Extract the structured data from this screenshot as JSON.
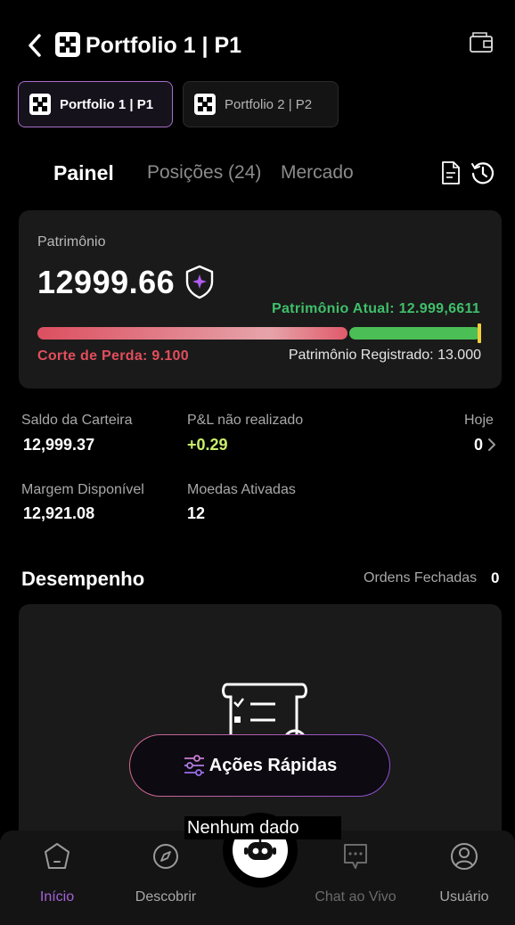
{
  "header": {
    "title": "Portfolio 1 | P1"
  },
  "portfolio_tabs": [
    {
      "label": "Portfolio 1 | P1",
      "active": true
    },
    {
      "label": "Portfolio 2 | P2",
      "active": false
    }
  ],
  "tabs": {
    "painel": "Painel",
    "posicoes": "Posições (24)",
    "mercado": "Mercado"
  },
  "equity": {
    "label": "Patrimônio",
    "value": "12999.66",
    "current_label": "Patrimônio Atual: 12.999,6611",
    "stop_loss": "Corte de Perda: 9.100",
    "registered": "Patrimônio Registrado: 13.000",
    "progress": {
      "stop_loss": 9100,
      "current": 12999.6611,
      "registered": 13000
    },
    "colors": {
      "loss": "#e24e5c",
      "gain": "#3fbf6a",
      "marker": "#f2cf3a"
    }
  },
  "stats": {
    "wallet_balance": {
      "label": "Saldo da Carteira",
      "value": "12,999.37"
    },
    "unrealized_pnl": {
      "label": "P&L não realizado",
      "value": "+0.29"
    },
    "today": {
      "label": "Hoje",
      "value": "0"
    },
    "available_margin": {
      "label": "Margem Disponível",
      "value": "12,921.08"
    },
    "active_coins": {
      "label": "Moedas Ativadas",
      "value": "12"
    }
  },
  "performance": {
    "title": "Desempenho",
    "closed_orders_label": "Ordens Fechadas",
    "closed_orders_value": "0",
    "empty_text": "Nenhum dado"
  },
  "quick_actions": {
    "label": "Ações Rápidas"
  },
  "bottom_nav": [
    {
      "label": "Início",
      "icon": "home-icon",
      "active": true
    },
    {
      "label": "Descobrir",
      "icon": "compass-icon",
      "active": false
    },
    {
      "label": "Chat ao Vivo",
      "icon": "chat-icon",
      "active": false
    },
    {
      "label": "Usuário",
      "icon": "user-icon",
      "active": false
    }
  ],
  "accent_color": "#a563d8"
}
